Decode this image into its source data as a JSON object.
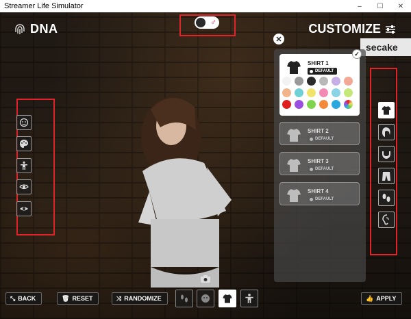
{
  "window": {
    "title": "Streamer Life Simulator",
    "buttons": [
      "–",
      "☐",
      "✕"
    ]
  },
  "header": {
    "dna_label": "DNA",
    "customize_label": "CUSTOMIZE",
    "gender_toggle_symbol": "♂"
  },
  "background_sign": "secake",
  "dna_tools": [
    {
      "name": "face-icon"
    },
    {
      "name": "palette-icon"
    },
    {
      "name": "body-icon"
    },
    {
      "name": "eye-shape-icon"
    },
    {
      "name": "eye-icon"
    }
  ],
  "panel": {
    "close_label": "✕",
    "check_label": "✓",
    "shirts": [
      {
        "name": "SHIRT 1",
        "badge": "DEFAULT",
        "selected": true
      },
      {
        "name": "SHIRT 2",
        "badge": "DEFAULT",
        "selected": false
      },
      {
        "name": "SHIRT 3",
        "badge": "DEFAULT",
        "selected": false
      },
      {
        "name": "SHIRT 4",
        "badge": "DEFAULT",
        "selected": false
      }
    ],
    "colors": [
      "#f2f2f2",
      "#9a9a9a",
      "#2a2a2a",
      "#b8b8b8",
      "#c8aee6",
      "#f2a894",
      "#f2b48a",
      "#6fd0d6",
      "#f2e46a",
      "#f28ab4",
      "#8ad4e6",
      "#c6e87a",
      "#e01e1e",
      "#9b4fe0",
      "#7fd44e",
      "#f28a3a",
      "#2aa8e0",
      "#custom"
    ]
  },
  "categories": [
    {
      "name": "shirt-icon",
      "selected": true
    },
    {
      "name": "hair-icon",
      "selected": false
    },
    {
      "name": "beard-icon",
      "selected": false
    },
    {
      "name": "pants-icon",
      "selected": false
    },
    {
      "name": "shoes-icon",
      "selected": false
    },
    {
      "name": "ear-icon",
      "selected": false
    }
  ],
  "footer": {
    "back_label": "BACK",
    "reset_label": "RESET",
    "randomize_label": "RANDOMIZE",
    "apply_label": "APPLY",
    "views": [
      {
        "name": "feet-view-icon",
        "selected": false
      },
      {
        "name": "face-view-icon",
        "selected": false
      },
      {
        "name": "shirt-view-icon",
        "selected": true
      },
      {
        "name": "full-body-view-icon",
        "selected": false
      }
    ]
  }
}
